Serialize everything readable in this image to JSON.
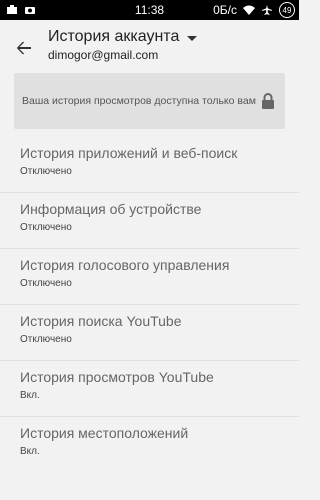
{
  "status_bar": {
    "time": "11:38",
    "data_rate": "0Б/с",
    "battery_level": "49"
  },
  "app_bar": {
    "title": "История аккаунта",
    "account": "dimogor@gmail.com"
  },
  "privacy_card": {
    "text": "Ваша история просмотров доступна только вам"
  },
  "items": [
    {
      "title": "История приложений и веб-поиск",
      "status": "Отключено"
    },
    {
      "title": "Информация об устройстве",
      "status": "Отключено"
    },
    {
      "title": "История голосового управления",
      "status": "Отключено"
    },
    {
      "title": "История поиска YouTube",
      "status": "Отключено"
    },
    {
      "title": "История просмотров YouTube",
      "status": "Вкл."
    },
    {
      "title": "История местоположений",
      "status": "Вкл."
    }
  ]
}
